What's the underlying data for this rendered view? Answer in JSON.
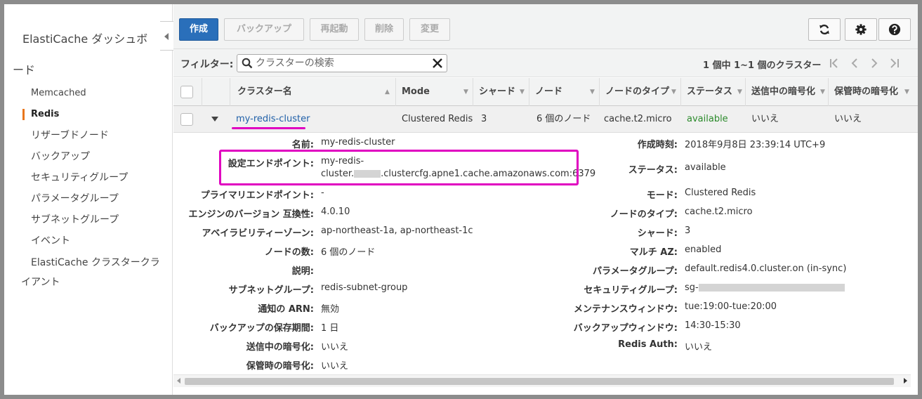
{
  "sidebar": {
    "title_line1": "ElastiCache ダッシュボ",
    "title_line2": "ード",
    "items": [
      {
        "label": "Memcached"
      },
      {
        "label": "Redis"
      },
      {
        "label": "リザーブドノード"
      },
      {
        "label": "バックアップ"
      },
      {
        "label": "セキュリティグループ"
      },
      {
        "label": "パラメータグループ"
      },
      {
        "label": "サブネットグループ"
      },
      {
        "label": "イベント"
      },
      {
        "label_line1": "ElastiCache クラスタークラ",
        "label_line2": "イアント"
      }
    ],
    "active": "Redis"
  },
  "toolbar": {
    "create_label": "作成",
    "backup_label": "バックアップ",
    "reboot_label": "再起動",
    "delete_label": "削除",
    "modify_label": "変更"
  },
  "filter": {
    "label": "フィルター:",
    "placeholder": "クラスターの検索",
    "pagination_text": "1 個中 1~1 個のクラスター"
  },
  "table": {
    "columns": [
      "クラスター名",
      "Mode",
      "シャード",
      "ノード",
      "ノードのタイプ",
      "ステータス",
      "送信中の暗号化",
      "保管時の暗号化"
    ],
    "rows": [
      {
        "name": "my-redis-cluster",
        "mode": "Clustered Redis",
        "shards": "3",
        "nodes": "6 個のノード",
        "node_type": "cache.t2.micro",
        "status": "available",
        "in_transit": "いいえ",
        "at_rest": "いいえ"
      }
    ]
  },
  "details": {
    "left": [
      {
        "label": "名前:",
        "value": "my-redis-cluster"
      },
      {
        "label": "設定エンドポイント:",
        "value_line1": "my-redis-",
        "value_line2_prefix": "cluster.",
        "value_line2_suffix": ".clustercfg.apne1.cache.amazonaws.com:6379"
      },
      {
        "label": "プライマリエンドポイント:",
        "value": "-"
      },
      {
        "label": "エンジンのバージョン 互換性:",
        "value": "4.0.10"
      },
      {
        "label": "アベイラビリティーゾーン:",
        "value": "ap-northeast-1a, ap-northeast-1c"
      },
      {
        "label": "ノードの数:",
        "value": "6 個のノード"
      },
      {
        "label": "説明:",
        "value": ""
      },
      {
        "label": "サブネットグループ:",
        "value": "redis-subnet-group"
      },
      {
        "label": "通知の ARN:",
        "value": "無効"
      },
      {
        "label": "バックアップの保存期間:",
        "value": "1 日"
      },
      {
        "label": "送信中の暗号化:",
        "value": "いいえ"
      },
      {
        "label": "保管時の暗号化:",
        "value": "いいえ"
      }
    ],
    "right": [
      {
        "label": "作成時刻:",
        "value": "2018年9月8日 23:39:14 UTC+9"
      },
      {
        "label": "ステータス:",
        "value": "available"
      },
      {
        "label": "モード:",
        "value": "Clustered Redis"
      },
      {
        "label": "ノードのタイプ:",
        "value": "cache.t2.micro"
      },
      {
        "label": "シャード:",
        "value": "3"
      },
      {
        "label": "マルチ AZ:",
        "value": "enabled"
      },
      {
        "label": "パラメータグループ:",
        "value": "default.redis4.0.cluster.on (in-sync)"
      },
      {
        "label": "セキュリティグループ:",
        "value": "sg-"
      },
      {
        "label": "メンテナンスウィンドウ:",
        "value": "tue:19:00-tue:20:00"
      },
      {
        "label": "バックアップウィンドウ:",
        "value": "14:30-15:30"
      },
      {
        "label": "Redis Auth:",
        "value": "いいえ"
      }
    ]
  },
  "colors": {
    "highlight": "#e000c0",
    "primary_button": "#2a6fba",
    "link": "#1f5fa8",
    "status_available": "#2b8a2b",
    "active_marker": "#e8761c"
  },
  "icons": [
    "refresh-icon",
    "gear-icon",
    "help-icon",
    "search-icon",
    "clear-icon",
    "first-page-icon",
    "prev-page-icon",
    "next-page-icon",
    "last-page-icon",
    "expand-icon"
  ]
}
